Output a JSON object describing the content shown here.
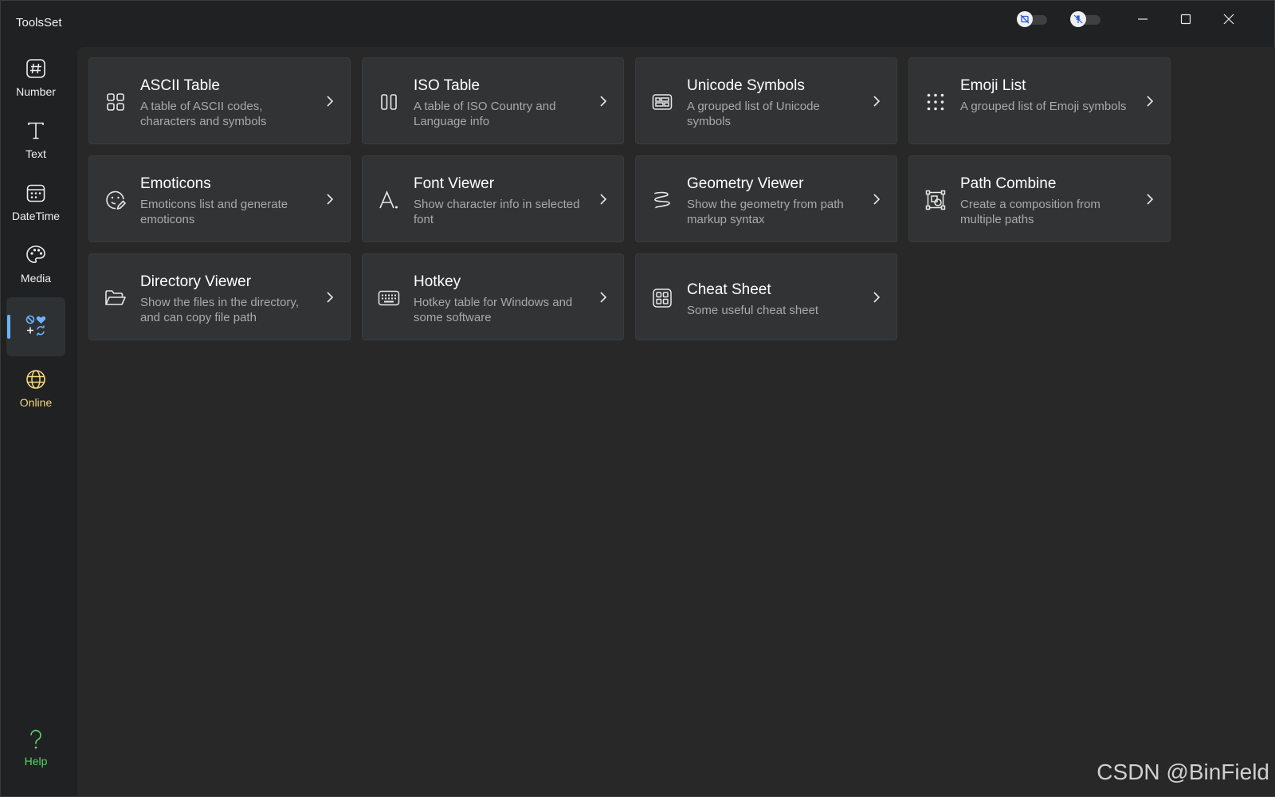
{
  "app": {
    "title": "ToolsSet"
  },
  "titlebar": {
    "toggles": [
      {
        "icon": "screenshot-block-icon"
      },
      {
        "icon": "pin-off-icon"
      }
    ],
    "buttons": [
      {
        "icon": "minimize-icon"
      },
      {
        "icon": "maximize-icon"
      },
      {
        "icon": "close-icon"
      }
    ]
  },
  "sidebar": {
    "items": [
      {
        "label": "Number",
        "icon": "hash-icon"
      },
      {
        "label": "Text",
        "icon": "text-t-icon"
      },
      {
        "label": "DateTime",
        "icon": "calendar-icon"
      },
      {
        "label": "Media",
        "icon": "palette-icon"
      },
      {
        "label": "",
        "icon": "math-symbols-icon",
        "selected": true
      },
      {
        "label": "Online",
        "icon": "globe-icon"
      }
    ],
    "help": {
      "label": "Help",
      "icon": "question-icon"
    }
  },
  "cards": [
    {
      "title": "ASCII Table",
      "desc": "A table of ASCII codes, characters and symbols",
      "icon": "grid-icon"
    },
    {
      "title": "ISO Table",
      "desc": "A table of ISO Country and Language info",
      "icon": "columns-icon"
    },
    {
      "title": "Unicode Symbols",
      "desc": "A grouped list of Unicode symbols",
      "icon": "symbols-board-icon"
    },
    {
      "title": "Emoji List",
      "desc": "A grouped list of Emoji symbols",
      "icon": "dots-grid-icon"
    },
    {
      "title": "Emoticons",
      "desc": "Emoticons list and generate emoticons",
      "icon": "emoji-edit-icon"
    },
    {
      "title": "Font Viewer",
      "desc": "Show character info in selected font",
      "icon": "font-icon"
    },
    {
      "title": "Geometry Viewer",
      "desc": "Show the geometry from path markup syntax",
      "icon": "squiggle-icon"
    },
    {
      "title": "Path Combine",
      "desc": "Create a composition from multiple paths",
      "icon": "shapes-combine-icon"
    },
    {
      "title": "Directory Viewer",
      "desc": "Show the files in the directory, and can copy file path",
      "icon": "folder-open-icon"
    },
    {
      "title": "Hotkey",
      "desc": "Hotkey table for Windows and some software",
      "icon": "keyboard-icon"
    },
    {
      "title": "Cheat Sheet",
      "desc": "Some useful cheat sheet",
      "icon": "cheat-sheet-icon"
    }
  ],
  "watermark": "CSDN @BinField",
  "colors": {
    "accent": "#6cb4ff",
    "online": "#f5d67a",
    "help": "#5fd35f",
    "card_bg": "#323334",
    "content_bg": "#282828"
  }
}
